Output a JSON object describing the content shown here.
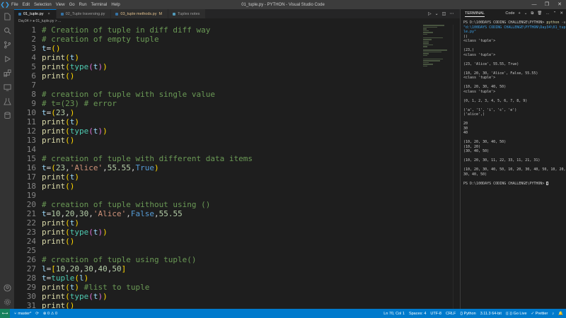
{
  "window": {
    "title": "01_tuple.py - PYTHON - Visual Studio Code",
    "menu": [
      "File",
      "Edit",
      "Selection",
      "View",
      "Go",
      "Run",
      "Terminal",
      "Help"
    ],
    "controls": [
      "—",
      "❐",
      "✕"
    ]
  },
  "tabs": [
    {
      "label": "01_tuple.py",
      "icon_color": "#3572a5",
      "active": true,
      "badge": "",
      "close": "×"
    },
    {
      "label": "02_Tuple traversing.py",
      "icon_color": "#3572a5",
      "active": false,
      "badge": "",
      "close": ""
    },
    {
      "label": "03_tuple methods.py",
      "icon_color": "#3572a5",
      "active": false,
      "badge": "M",
      "close": ""
    },
    {
      "label": "Tuples notes",
      "icon_color": "#519aba",
      "active": false,
      "badge": "",
      "close": ""
    }
  ],
  "breadcrumb": "Day34 > ● 01_tuple.py > ...",
  "code_lines": [
    {
      "n": "1",
      "t": [
        [
          "c-com",
          "# Creation of tuple in diff diff way"
        ]
      ]
    },
    {
      "n": "2",
      "t": [
        [
          "c-com",
          "# creation of empty tuple"
        ]
      ]
    },
    {
      "n": "3",
      "t": [
        [
          "c-var",
          "t"
        ],
        [
          "c-op",
          "="
        ],
        [
          "c-p1",
          "()"
        ]
      ]
    },
    {
      "n": "4",
      "t": [
        [
          "c-fn",
          "print"
        ],
        [
          "c-p1",
          "("
        ],
        [
          "c-var",
          "t"
        ],
        [
          "c-p1",
          ")"
        ]
      ]
    },
    {
      "n": "5",
      "t": [
        [
          "c-fn",
          "print"
        ],
        [
          "c-p1",
          "("
        ],
        [
          "c-type",
          "type"
        ],
        [
          "c-p2",
          "("
        ],
        [
          "c-var",
          "t"
        ],
        [
          "c-p2",
          ")"
        ],
        [
          "c-p1",
          ")"
        ]
      ]
    },
    {
      "n": "6",
      "t": [
        [
          "c-fn",
          "print"
        ],
        [
          "c-p1",
          "()"
        ]
      ]
    },
    {
      "n": "7",
      "t": []
    },
    {
      "n": "8",
      "t": [
        [
          "c-com",
          "# creation of tuple with single value"
        ]
      ]
    },
    {
      "n": "9",
      "t": [
        [
          "c-com",
          "# t=(23) # error"
        ]
      ]
    },
    {
      "n": "10",
      "t": [
        [
          "c-var",
          "t"
        ],
        [
          "c-op",
          "="
        ],
        [
          "c-p1",
          "("
        ],
        [
          "c-num",
          "23"
        ],
        [
          "c-op",
          ","
        ],
        [
          "c-p1",
          ")"
        ]
      ]
    },
    {
      "n": "11",
      "t": [
        [
          "c-fn",
          "print"
        ],
        [
          "c-p1",
          "("
        ],
        [
          "c-var",
          "t"
        ],
        [
          "c-p1",
          ")"
        ]
      ]
    },
    {
      "n": "12",
      "t": [
        [
          "c-fn",
          "print"
        ],
        [
          "c-p1",
          "("
        ],
        [
          "c-type",
          "type"
        ],
        [
          "c-p2",
          "("
        ],
        [
          "c-var",
          "t"
        ],
        [
          "c-p2",
          ")"
        ],
        [
          "c-p1",
          ")"
        ]
      ]
    },
    {
      "n": "13",
      "t": [
        [
          "c-fn",
          "print"
        ],
        [
          "c-p1",
          "()"
        ]
      ]
    },
    {
      "n": "14",
      "t": []
    },
    {
      "n": "15",
      "t": [
        [
          "c-com",
          "# creation of tuple with different data items"
        ]
      ]
    },
    {
      "n": "16",
      "t": [
        [
          "c-var",
          "t"
        ],
        [
          "c-op",
          "="
        ],
        [
          "c-p1",
          "("
        ],
        [
          "c-num",
          "23"
        ],
        [
          "c-op",
          ","
        ],
        [
          "c-str",
          "'Alice'"
        ],
        [
          "c-op",
          ","
        ],
        [
          "c-num",
          "55.55"
        ],
        [
          "c-op",
          ","
        ],
        [
          "c-kw",
          "True"
        ],
        [
          "c-p1",
          ")"
        ]
      ]
    },
    {
      "n": "17",
      "t": [
        [
          "c-fn",
          "print"
        ],
        [
          "c-p1",
          "("
        ],
        [
          "c-var",
          "t"
        ],
        [
          "c-p1",
          ")"
        ]
      ]
    },
    {
      "n": "18",
      "t": [
        [
          "c-fn",
          "print"
        ],
        [
          "c-p1",
          "()"
        ]
      ]
    },
    {
      "n": "19",
      "t": []
    },
    {
      "n": "20",
      "t": [
        [
          "c-com",
          "# creation of tuple without using ()"
        ]
      ]
    },
    {
      "n": "21",
      "t": [
        [
          "c-var",
          "t"
        ],
        [
          "c-op",
          "="
        ],
        [
          "c-num",
          "10"
        ],
        [
          "c-op",
          ","
        ],
        [
          "c-num",
          "20"
        ],
        [
          "c-op",
          ","
        ],
        [
          "c-num",
          "30"
        ],
        [
          "c-op",
          ","
        ],
        [
          "c-str",
          "'Alice'"
        ],
        [
          "c-op",
          ","
        ],
        [
          "c-kw",
          "False"
        ],
        [
          "c-op",
          ","
        ],
        [
          "c-num",
          "55.55"
        ]
      ]
    },
    {
      "n": "22",
      "t": [
        [
          "c-fn",
          "print"
        ],
        [
          "c-p1",
          "("
        ],
        [
          "c-var",
          "t"
        ],
        [
          "c-p1",
          ")"
        ]
      ]
    },
    {
      "n": "23",
      "t": [
        [
          "c-fn",
          "print"
        ],
        [
          "c-p1",
          "("
        ],
        [
          "c-type",
          "type"
        ],
        [
          "c-p2",
          "("
        ],
        [
          "c-var",
          "t"
        ],
        [
          "c-p2",
          ")"
        ],
        [
          "c-p1",
          ")"
        ]
      ]
    },
    {
      "n": "24",
      "t": [
        [
          "c-fn",
          "print"
        ],
        [
          "c-p1",
          "()"
        ]
      ]
    },
    {
      "n": "25",
      "t": []
    },
    {
      "n": "26",
      "t": [
        [
          "c-com",
          "# creation of tuple using tuple()"
        ]
      ]
    },
    {
      "n": "27",
      "t": [
        [
          "c-var",
          "l"
        ],
        [
          "c-op",
          "="
        ],
        [
          "c-p1",
          "["
        ],
        [
          "c-num",
          "10"
        ],
        [
          "c-op",
          ","
        ],
        [
          "c-num",
          "20"
        ],
        [
          "c-op",
          ","
        ],
        [
          "c-num",
          "30"
        ],
        [
          "c-op",
          ","
        ],
        [
          "c-num",
          "40"
        ],
        [
          "c-op",
          ","
        ],
        [
          "c-num",
          "50"
        ],
        [
          "c-p1",
          "]"
        ]
      ]
    },
    {
      "n": "28",
      "t": [
        [
          "c-var",
          "t"
        ],
        [
          "c-op",
          "="
        ],
        [
          "c-type",
          "tuple"
        ],
        [
          "c-p1",
          "("
        ],
        [
          "c-var",
          "l"
        ],
        [
          "c-p1",
          ")"
        ]
      ]
    },
    {
      "n": "29",
      "t": [
        [
          "c-fn",
          "print"
        ],
        [
          "c-p1",
          "("
        ],
        [
          "c-var",
          "t"
        ],
        [
          "c-p1",
          ")"
        ],
        [
          "c-op",
          " "
        ],
        [
          "c-com",
          "#list to tuple"
        ]
      ]
    },
    {
      "n": "30",
      "t": [
        [
          "c-fn",
          "print"
        ],
        [
          "c-p1",
          "("
        ],
        [
          "c-type",
          "type"
        ],
        [
          "c-p2",
          "("
        ],
        [
          "c-var",
          "t"
        ],
        [
          "c-p2",
          ")"
        ],
        [
          "c-p1",
          ")"
        ]
      ]
    },
    {
      "n": "31",
      "t": [
        [
          "c-fn",
          "print"
        ],
        [
          "c-p1",
          "()"
        ]
      ]
    }
  ],
  "panel": {
    "title": "TERMINAL",
    "shell": "Code",
    "actions": [
      "+",
      "⌄",
      "⧉",
      "🗑",
      "…",
      "⌃",
      "✕"
    ]
  },
  "terminal_lines": [
    {
      "k": "cmd",
      "prompt": "PS D:\\100DAYS CODING CHALLENGE\\PYTHON> ",
      "cmd": "python",
      "flag": " -u ",
      "str": "\"d:\\100DAYS CODING CHALLENGE\\PYTHON\\Day34\\01_tuple.py\""
    },
    {
      "k": "out",
      "v": "()"
    },
    {
      "k": "out",
      "v": "<class 'tuple'>"
    },
    {
      "k": "blank"
    },
    {
      "k": "out",
      "v": "(23,)"
    },
    {
      "k": "out",
      "v": "<class 'tuple'>"
    },
    {
      "k": "blank"
    },
    {
      "k": "out",
      "v": "(23, 'Alice', 55.55, True)"
    },
    {
      "k": "blank"
    },
    {
      "k": "out",
      "v": "(10, 20, 30, 'Alice', False, 55.55)"
    },
    {
      "k": "out",
      "v": "<class 'tuple'>"
    },
    {
      "k": "blank"
    },
    {
      "k": "out",
      "v": "(10, 20, 30, 40, 50)"
    },
    {
      "k": "out",
      "v": "<class 'tuple'>"
    },
    {
      "k": "blank"
    },
    {
      "k": "out",
      "v": "(0, 1, 2, 3, 4, 5, 6, 7, 8, 9)"
    },
    {
      "k": "blank"
    },
    {
      "k": "out",
      "v": "('a', 'l', 'i', 'c', 'e')"
    },
    {
      "k": "out",
      "v": "('alice',)"
    },
    {
      "k": "blank"
    },
    {
      "k": "out",
      "v": "20"
    },
    {
      "k": "out",
      "v": "30"
    },
    {
      "k": "out",
      "v": "40"
    },
    {
      "k": "blank"
    },
    {
      "k": "out",
      "v": "(10, 20, 30, 40, 50)"
    },
    {
      "k": "out",
      "v": "(10, 20)"
    },
    {
      "k": "out",
      "v": "(30, 40, 50)"
    },
    {
      "k": "blank"
    },
    {
      "k": "out",
      "v": "(10, 20, 30, 11, 22, 33, 11, 21, 31)"
    },
    {
      "k": "blank"
    },
    {
      "k": "out",
      "v": "(10, 20, 30, 40, 50, 10, 20, 30, 40, 50, 10, 20, 30, 40, 50)"
    },
    {
      "k": "blank"
    },
    {
      "k": "prompt",
      "v": "PS D:\\100DAYS CODING CHALLENGE\\PYTHON> "
    }
  ],
  "statusbar": {
    "remote_icon": "⟷",
    "branch": "master*",
    "sync": "⟳",
    "problems": "⊗ 0  ⚠ 0",
    "right": [
      "Ln 70, Col 1",
      "Spaces: 4",
      "UTF-8",
      "CRLF",
      "{} Python",
      "3.11.3 64-bit",
      "((·)) Go Live",
      "✓ Prettier",
      "♪",
      "🔔"
    ]
  }
}
